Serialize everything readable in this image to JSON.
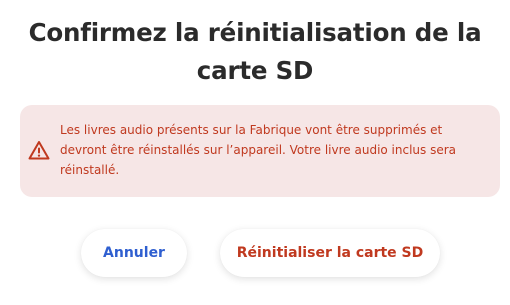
{
  "dialog": {
    "title": "Confirmez la réinitialisation de la carte SD",
    "alert": {
      "icon": "warning-triangle-icon",
      "message": "Les livres audio présents sur la Fabrique vont être supprimés et devront être réinstallés sur l’appareil. Votre livre audio inclus sera réinstallé.",
      "text_color": "#c0391f",
      "background_color": "#f6e6e6"
    },
    "buttons": {
      "cancel_label": "Annuler",
      "confirm_label": "Réinitialiser la carte SD",
      "cancel_color": "#2f5fd0",
      "confirm_color": "#c0391f"
    }
  }
}
